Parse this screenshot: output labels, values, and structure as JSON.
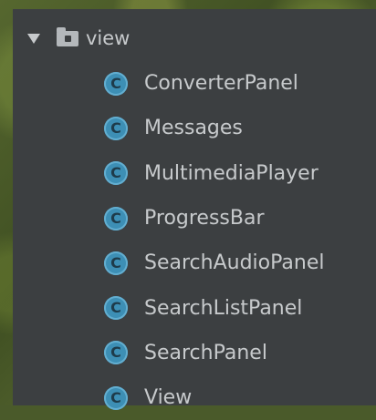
{
  "tree": {
    "folder": {
      "label": "view",
      "icon": "folder-icon",
      "expanded": true
    },
    "class_icon_glyph": "C",
    "items": [
      {
        "label": "ConverterPanel",
        "icon": "class-icon"
      },
      {
        "label": "Messages",
        "icon": "class-icon"
      },
      {
        "label": "MultimediaPlayer",
        "icon": "class-icon"
      },
      {
        "label": "ProgressBar",
        "icon": "class-icon"
      },
      {
        "label": "SearchAudioPanel",
        "icon": "class-icon"
      },
      {
        "label": "SearchListPanel",
        "icon": "class-icon"
      },
      {
        "label": "SearchPanel",
        "icon": "class-icon"
      },
      {
        "label": "View",
        "icon": "class-icon"
      }
    ]
  },
  "colors": {
    "panel_background": "#3c3f41",
    "text": "#c7cacc",
    "class_icon": "#3d8fb5"
  }
}
